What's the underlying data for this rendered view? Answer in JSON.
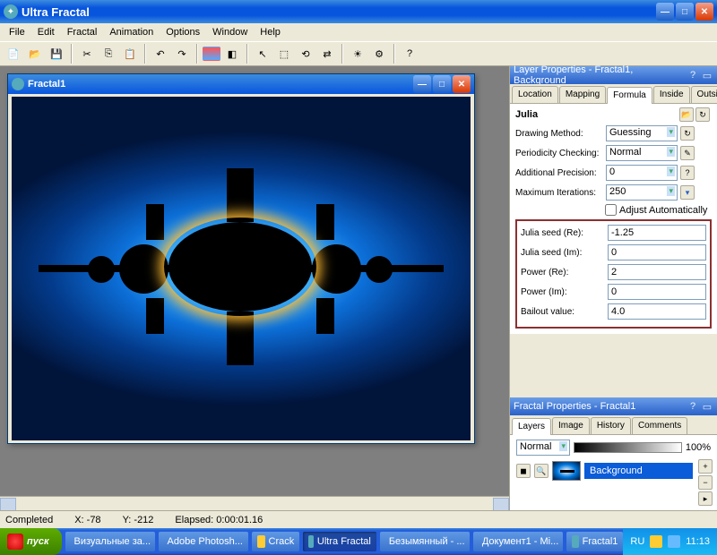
{
  "app": {
    "title": "Ultra Fractal"
  },
  "menu": [
    "File",
    "Edit",
    "Fractal",
    "Animation",
    "Options",
    "Window",
    "Help"
  ],
  "doc": {
    "title": "Fractal1"
  },
  "layerPanel": {
    "title": "Layer Properties - Fractal1, Background",
    "tabs": [
      "Location",
      "Mapping",
      "Formula",
      "Inside",
      "Outside"
    ],
    "activeTab": "Formula",
    "formulaName": "Julia",
    "drawingMethod": {
      "label": "Drawing Method:",
      "value": "Guessing"
    },
    "periodicity": {
      "label": "Periodicity Checking:",
      "value": "Normal"
    },
    "precision": {
      "label": "Additional Precision:",
      "value": "0"
    },
    "maxIter": {
      "label": "Maximum Iterations:",
      "value": "250"
    },
    "adjustAuto": "Adjust Automatically",
    "params": [
      {
        "label": "Julia seed (Re):",
        "value": "-1.25"
      },
      {
        "label": "Julia seed (Im):",
        "value": "0"
      },
      {
        "label": "Power (Re):",
        "value": "2"
      },
      {
        "label": "Power (Im):",
        "value": "0"
      },
      {
        "label": "Bailout value:",
        "value": "4.0"
      }
    ]
  },
  "fractalPanel": {
    "title": "Fractal Properties - Fractal1",
    "tabs": [
      "Layers",
      "Image",
      "History",
      "Comments"
    ],
    "activeTab": "Layers",
    "blendMode": "Normal",
    "opacity": "100%",
    "layerName": "Background"
  },
  "status": {
    "state": "Completed",
    "x": "X: -78",
    "y": "Y: -212",
    "elapsed": "Elapsed: 0:00:01.16"
  },
  "taskbar": {
    "start": "пуск",
    "items": [
      "Визуальные за...",
      "Adobe Photosh...",
      "Crack",
      "Ultra Fractal",
      "Безымянный - ...",
      "Документ1 - Mi...",
      "Fractal1"
    ],
    "activeIndex": 3,
    "lang": "RU",
    "time": "11:13"
  }
}
